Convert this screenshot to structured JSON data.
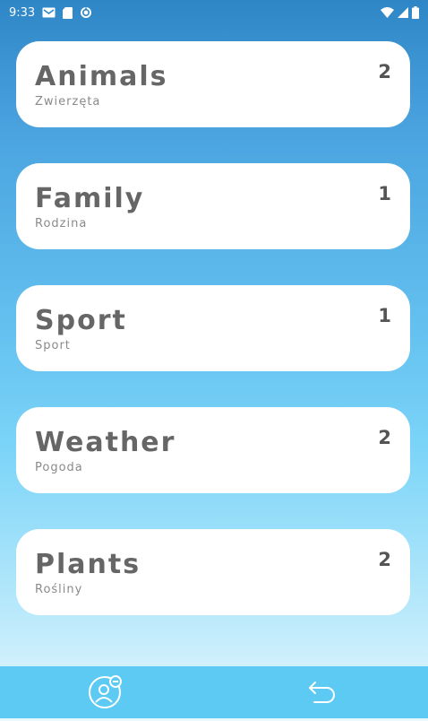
{
  "status_bar": {
    "time": "9:33"
  },
  "categories": [
    {
      "title": "Animals",
      "subtitle": "Zwierzęta",
      "count": "2"
    },
    {
      "title": "Family",
      "subtitle": "Rodzina",
      "count": "1"
    },
    {
      "title": "Sport",
      "subtitle": "Sport",
      "count": "1"
    },
    {
      "title": "Weather",
      "subtitle": "Pogoda",
      "count": "2"
    },
    {
      "title": "Plants",
      "subtitle": "Rośliny",
      "count": "2"
    }
  ],
  "bottom_nav": {
    "items": [
      {
        "icon": "profile-icon"
      },
      {
        "icon": "back-arrow-icon"
      }
    ]
  },
  "colors": {
    "bottom_bar": "#5ccaf3",
    "card_background": "#ffffff",
    "title_text": "#666666"
  }
}
